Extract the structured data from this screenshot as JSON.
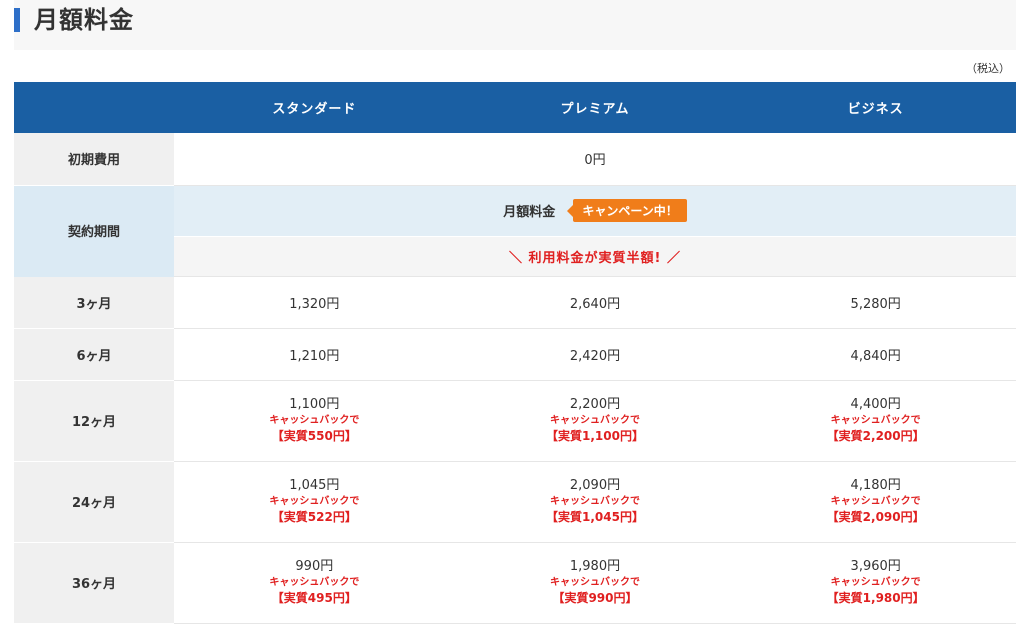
{
  "title": "月額料金",
  "tax_note": "（税込）",
  "columns": [
    "スタンダード",
    "プレミアム",
    "ビジネス"
  ],
  "initial_fee": {
    "label": "初期費用",
    "value": "0円"
  },
  "contract": {
    "label": "契約期間",
    "monthly_label": "月額料金",
    "campaign_badge": "キャンペーン中！",
    "half_price_text": "＼ 利用料金が実質半額! ／"
  },
  "rows": [
    {
      "period": "3ヶ月",
      "prices": [
        "1,320円",
        "2,640円",
        "5,280円"
      ]
    },
    {
      "period": "6ヶ月",
      "prices": [
        "1,210円",
        "2,420円",
        "4,840円"
      ]
    },
    {
      "period": "12ヶ月",
      "prices": [
        "1,100円",
        "2,200円",
        "4,400円"
      ],
      "cashback": [
        "キャッシュバックで",
        "キャッシュバックで",
        "キャッシュバックで"
      ],
      "effective": [
        "【実質550円】",
        "【実質1,100円】",
        "【実質2,200円】"
      ]
    },
    {
      "period": "24ヶ月",
      "prices": [
        "1,045円",
        "2,090円",
        "4,180円"
      ],
      "cashback": [
        "キャッシュバックで",
        "キャッシュバックで",
        "キャッシュバックで"
      ],
      "effective": [
        "【実質522円】",
        "【実質1,045円】",
        "【実質2,090円】"
      ]
    },
    {
      "period": "36ヶ月",
      "prices": [
        "990円",
        "1,980円",
        "3,960円"
      ],
      "cashback": [
        "キャッシュバックで",
        "キャッシュバックで",
        "キャッシュバックで"
      ],
      "effective": [
        "【実質495円】",
        "【実質990円】",
        "【実質1,980円】"
      ]
    }
  ],
  "colors": {
    "header_bg": "#1a5fa3",
    "accent_red": "#e02020",
    "badge_orange": "#f07d1a",
    "heading_bar": "#2e6fc8"
  }
}
